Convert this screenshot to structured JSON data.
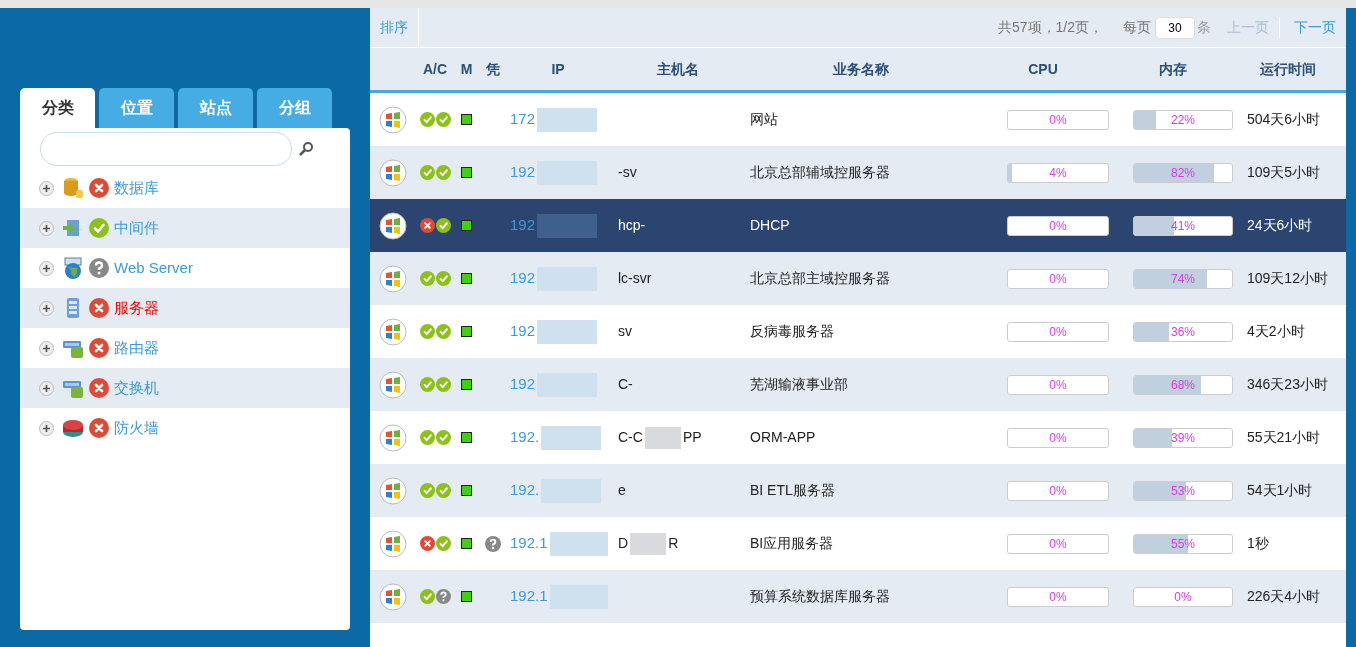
{
  "sidebar": {
    "tabs": [
      {
        "label": "分类",
        "selected": true
      },
      {
        "label": "位置",
        "selected": false
      },
      {
        "label": "站点",
        "selected": false
      },
      {
        "label": "分组",
        "selected": false
      }
    ],
    "items": [
      {
        "label": "数据库",
        "kind": "database",
        "status": {
          "kind": "error"
        },
        "alert": false
      },
      {
        "label": "中间件",
        "kind": "middleware",
        "status": {
          "kind": "ok"
        },
        "alert": false
      },
      {
        "label": "Web Server",
        "kind": "web",
        "status": {
          "kind": "unknown"
        },
        "alert": false
      },
      {
        "label": "服务器",
        "kind": "server",
        "status": {
          "kind": "error"
        },
        "alert": true
      },
      {
        "label": "路由器",
        "kind": "router",
        "status": {
          "kind": "error"
        },
        "alert": false
      },
      {
        "label": "交换机",
        "kind": "switch",
        "status": {
          "kind": "error"
        },
        "alert": false
      },
      {
        "label": "防火墙",
        "kind": "firewall",
        "status": {
          "kind": "error"
        },
        "alert": false
      }
    ]
  },
  "toolbar": {
    "sort": "排序",
    "summary": "共57项，1/2页，",
    "per_page_label": "每页",
    "per_page": "30",
    "per_page_unit": "条",
    "prev": "上一页",
    "next": "下一页"
  },
  "table": {
    "columns": [
      "A/C",
      "M",
      "凭",
      "IP",
      "主机名",
      "业务名称",
      "CPU",
      "内存",
      "运行时间"
    ],
    "rows": [
      {
        "checks": [
          {
            "kind": "ok"
          },
          {
            "kind": "ok"
          }
        ],
        "cred": false,
        "ip": "172",
        "host": [],
        "business": "网站",
        "cpu": {
          "text": "0%",
          "level": 0
        },
        "mem": {
          "text": "22%",
          "level": 0.22
        },
        "uptime": "504天6小时",
        "selected": false
      },
      {
        "checks": [
          {
            "kind": "ok"
          },
          {
            "kind": "ok"
          }
        ],
        "cred": false,
        "ip": "192",
        "host": [
          "-sv"
        ],
        "business": "北京总部辅域控服务器",
        "cpu": {
          "text": "4%",
          "level": 0.04
        },
        "mem": {
          "text": "82%",
          "level": 0.82
        },
        "uptime": "109天5小时",
        "selected": false
      },
      {
        "checks": [
          {
            "kind": "error"
          },
          {
            "kind": "ok"
          }
        ],
        "cred": false,
        "ip": "192",
        "host": [
          "hcp-"
        ],
        "business": "DHCP",
        "cpu": {
          "text": "0%",
          "level": 0
        },
        "mem": {
          "text": "41%",
          "level": 0.41
        },
        "uptime": "24天6小时",
        "selected": true
      },
      {
        "checks": [
          {
            "kind": "ok"
          },
          {
            "kind": "ok"
          }
        ],
        "cred": false,
        "ip": "192",
        "host": [
          "lc-svr"
        ],
        "business": "北京总部主域控服务器",
        "cpu": {
          "text": "0%",
          "level": 0
        },
        "mem": {
          "text": "74%",
          "level": 0.74
        },
        "uptime": "109天12小时",
        "selected": false
      },
      {
        "checks": [
          {
            "kind": "ok"
          },
          {
            "kind": "ok"
          }
        ],
        "cred": false,
        "ip": "192",
        "host": [
          "sv"
        ],
        "business": "反病毒服务器",
        "cpu": {
          "text": "0%",
          "level": 0
        },
        "mem": {
          "text": "36%",
          "level": 0.36
        },
        "uptime": "4天2小时",
        "selected": false
      },
      {
        "checks": [
          {
            "kind": "ok"
          },
          {
            "kind": "ok"
          }
        ],
        "cred": false,
        "ip": "192",
        "host": [
          "C-"
        ],
        "business": "芜湖输液事业部",
        "cpu": {
          "text": "0%",
          "level": 0
        },
        "mem": {
          "text": "68%",
          "level": 0.68
        },
        "uptime": "346天23小时",
        "selected": false
      },
      {
        "checks": [
          {
            "kind": "ok"
          },
          {
            "kind": "ok"
          }
        ],
        "cred": false,
        "ip": "192.",
        "host": [
          "C-C",
          "PP"
        ],
        "business": "ORM-APP",
        "cpu": {
          "text": "0%",
          "level": 0
        },
        "mem": {
          "text": "39%",
          "level": 0.39
        },
        "uptime": "55天21小时",
        "selected": false
      },
      {
        "checks": [
          {
            "kind": "ok"
          },
          {
            "kind": "ok"
          }
        ],
        "cred": false,
        "ip": "192.",
        "host": [
          "e"
        ],
        "business": "BI ETL服务器",
        "cpu": {
          "text": "0%",
          "level": 0
        },
        "mem": {
          "text": "53%",
          "level": 0.53
        },
        "uptime": "54天1小时",
        "selected": false
      },
      {
        "checks": [
          {
            "kind": "error"
          },
          {
            "kind": "ok"
          }
        ],
        "cred": true,
        "ip": "192.1",
        "host": [
          "D",
          "R"
        ],
        "business": "BI应用服务器",
        "cpu": {
          "text": "0%",
          "level": 0
        },
        "mem": {
          "text": "55%",
          "level": 0.55
        },
        "uptime": "1秒",
        "selected": false
      },
      {
        "checks": [
          {
            "kind": "ok"
          },
          {
            "kind": "unknown"
          }
        ],
        "cred": false,
        "ip": "192.1",
        "host": [],
        "business": "预算系统数据库服务器",
        "cpu": {
          "text": "0%",
          "level": 0
        },
        "mem": {
          "text": "0%",
          "level": 0
        },
        "uptime": "226天4小时",
        "selected": false
      }
    ]
  }
}
